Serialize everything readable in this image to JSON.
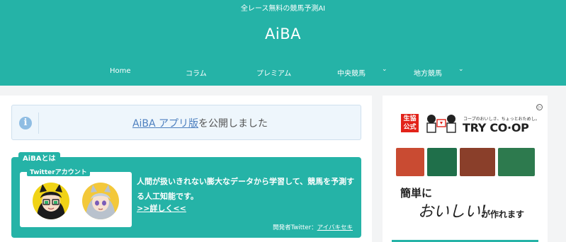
{
  "header": {
    "tagline": "全レース無料の競馬予測AI",
    "site_title": "AiBA",
    "bg_color": "#25b3a7"
  },
  "nav": {
    "items": [
      {
        "label": "Home",
        "has_dropdown": false
      },
      {
        "label": "コラム",
        "has_dropdown": false
      },
      {
        "label": "プレミアム",
        "has_dropdown": false
      },
      {
        "label": "中央競馬",
        "has_dropdown": true
      },
      {
        "label": "地方競馬",
        "has_dropdown": true
      }
    ],
    "caret": "⌄"
  },
  "notice": {
    "icon": "info-icon",
    "link_text": "AiBA アプリ版",
    "text": "を公開しました"
  },
  "about": {
    "label": "AiBAとは",
    "twitter_label": "Twitterアカウント",
    "description": "人間が扱いきれない膨大なデータから学習して、競馬を予測する人工知能です。",
    "more_link": ">>詳しく<<",
    "developer_prefix": "開発者Twitter：",
    "developer_link": "アイバキセキ"
  },
  "ad": {
    "badge": [
      "生協",
      "公式"
    ],
    "tagline": "コープのおいしさ、ちょっとおためし。",
    "logo": "TRY CO·OP",
    "line1": "簡単に",
    "line2": "おいしい!",
    "line3": "が作れます",
    "choice_icon": "adchoices-icon"
  }
}
